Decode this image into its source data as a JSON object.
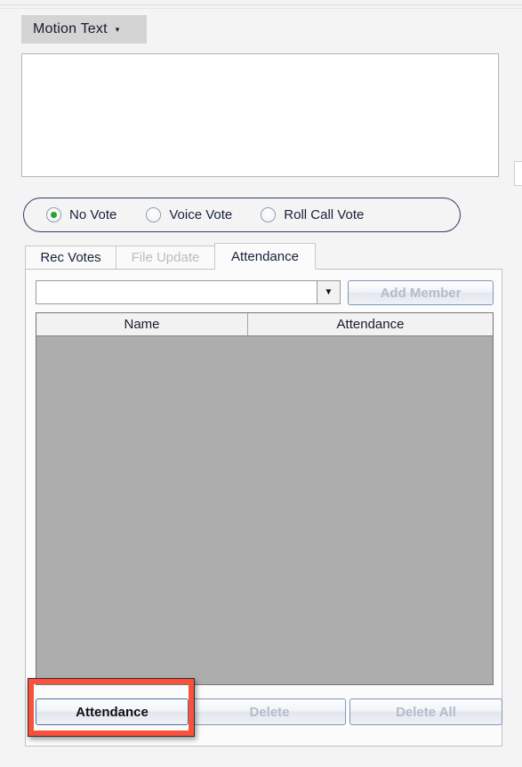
{
  "window": {
    "background_color": "#f4f4f4"
  },
  "toolbar": {
    "motion_text_label": "Motion Text",
    "motion_text_caret": "▾"
  },
  "motion_text": {
    "value": "",
    "placeholder": ""
  },
  "vote_type": {
    "border_color": "#2b3c66",
    "selected": "No Vote",
    "options": [
      {
        "label": "No Vote",
        "checked": true
      },
      {
        "label": "Voice Vote",
        "checked": false
      },
      {
        "label": "Roll Call Vote",
        "checked": false
      }
    ]
  },
  "tabs": {
    "selected": "Attendance",
    "items": [
      {
        "label": "Rec Votes",
        "state": "normal"
      },
      {
        "label": "File Update",
        "state": "disabled"
      },
      {
        "label": "Attendance",
        "state": "selected"
      }
    ]
  },
  "attendance_panel": {
    "member_combo": {
      "value": "",
      "placeholder": "",
      "arrow_glyph": "▼"
    },
    "add_member_button": {
      "label": "Add Member",
      "enabled": false
    },
    "grid": {
      "columns": [
        "Name",
        "Attendance"
      ],
      "rows": [],
      "empty_body_color": "#adadad"
    },
    "buttons": [
      {
        "label": "Attendance",
        "enabled": true
      },
      {
        "label": "Delete",
        "enabled": false
      },
      {
        "label": "Delete All",
        "enabled": false
      }
    ]
  },
  "annotation": {
    "color": "#f9523c",
    "target": "Attendance"
  }
}
